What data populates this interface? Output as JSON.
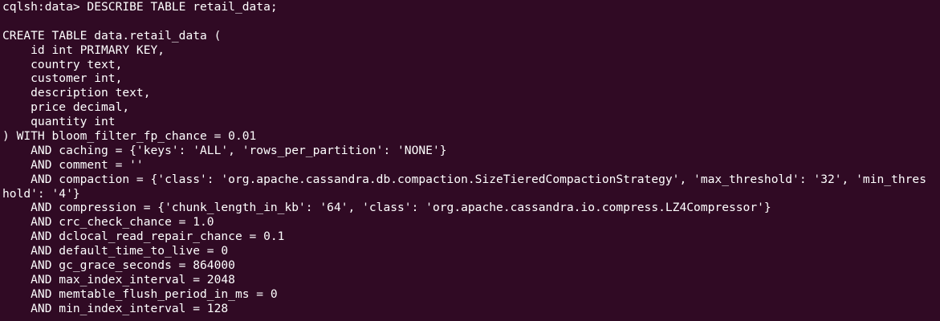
{
  "terminal": {
    "lines": [
      "cqlsh:data> DESCRIBE TABLE retail_data;",
      "",
      "CREATE TABLE data.retail_data (",
      "    id int PRIMARY KEY,",
      "    country text,",
      "    customer int,",
      "    description text,",
      "    price decimal,",
      "    quantity int",
      ") WITH bloom_filter_fp_chance = 0.01",
      "    AND caching = {'keys': 'ALL', 'rows_per_partition': 'NONE'}",
      "    AND comment = ''",
      "    AND compaction = {'class': 'org.apache.cassandra.db.compaction.SizeTieredCompactionStrategy', 'max_threshold': '32', 'min_thres",
      "hold': '4'}",
      "    AND compression = {'chunk_length_in_kb': '64', 'class': 'org.apache.cassandra.io.compress.LZ4Compressor'}",
      "    AND crc_check_chance = 1.0",
      "    AND dclocal_read_repair_chance = 0.1",
      "    AND default_time_to_live = 0",
      "    AND gc_grace_seconds = 864000",
      "    AND max_index_interval = 2048",
      "    AND memtable_flush_period_in_ms = 0",
      "    AND min_index_interval = 128"
    ]
  }
}
